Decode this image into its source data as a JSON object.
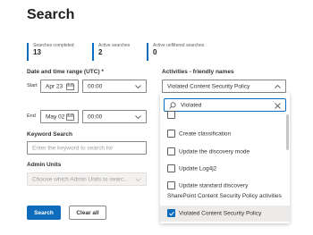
{
  "page": {
    "title": "Search"
  },
  "stats": [
    {
      "label": "Searches completed",
      "value": "13"
    },
    {
      "label": "Active searches",
      "value": "2"
    },
    {
      "label": "Active unfiltered searches",
      "value": "0"
    }
  ],
  "date_range": {
    "label": "Date and time range (UTC) *",
    "start_label": "Start",
    "start_date": "Apr 23",
    "start_time": "00:00",
    "end_label": "End",
    "end_date": "May 02",
    "end_time": "00:00"
  },
  "keyword": {
    "label": "Keyword Search",
    "placeholder": "Enter the keyword to search for"
  },
  "admin_units": {
    "label": "Admin Units",
    "placeholder": "Choose which Admin Units to searc..."
  },
  "activities": {
    "label": "Activities - friendly names",
    "selected_value": "Violated Content Security Policy",
    "search_value": "Violated",
    "options": [
      {
        "label": "Create classification",
        "checked": false
      },
      {
        "label": "Update the discovery mode",
        "checked": false
      },
      {
        "label": "Update Log4j2",
        "checked": false
      },
      {
        "label": "Update standard discovery",
        "checked": false
      }
    ],
    "group_header": "SharePoint Content Security Policy activities",
    "group_options": [
      {
        "label": "Violated Content Security Policy",
        "checked": true
      }
    ]
  },
  "buttons": {
    "search": "Search",
    "clear": "Clear all"
  },
  "colors": {
    "accent": "#0f6cbd"
  }
}
